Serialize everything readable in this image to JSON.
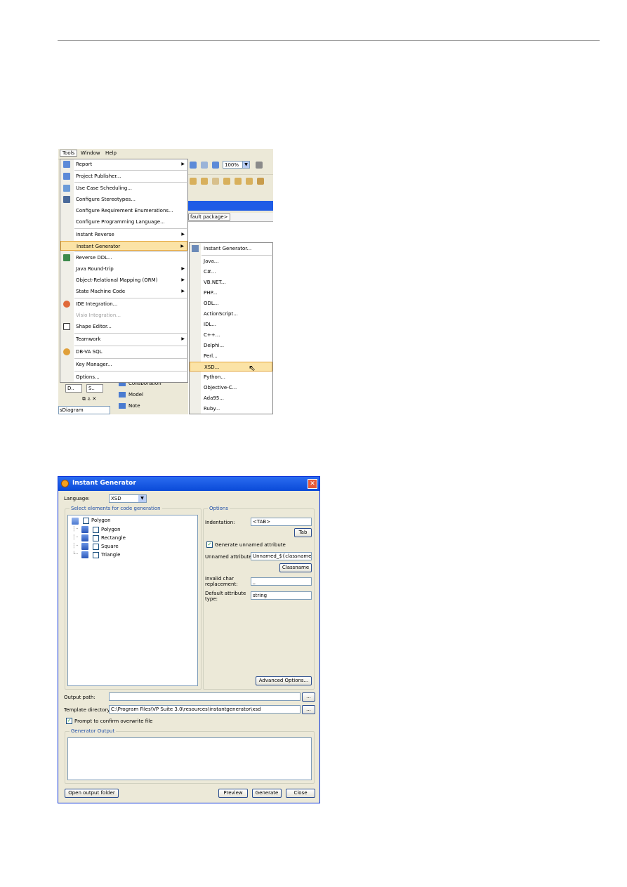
{
  "menubar": {
    "tools": "Tools",
    "window": "Window",
    "help": "Help"
  },
  "toolbar": {
    "zoom": "100%"
  },
  "package_tab": "fault package>",
  "left_panel": {
    "tab1": "D..",
    "tab2": "S..",
    "diagram_select": "sDiagram"
  },
  "diagram_panel": [
    "Collaboration",
    "Model",
    "Note"
  ],
  "tools_menu": [
    {
      "label": "Report",
      "submenu": true
    },
    {
      "label": "Project Publisher..."
    },
    {
      "label": "Use Case Scheduling..."
    },
    {
      "label": "Configure Stereotypes..."
    },
    {
      "label": "Configure Requirement Enumerations..."
    },
    {
      "label": "Configure Programming Language..."
    },
    {
      "label": "Instant Reverse",
      "submenu": true
    },
    {
      "label": "Instant Generator",
      "submenu": true,
      "highlighted": true
    },
    {
      "label": "Reverse DDL..."
    },
    {
      "label": "Java Round-trip",
      "submenu": true
    },
    {
      "label": "Object-Relational Mapping (ORM)",
      "submenu": true
    },
    {
      "label": "State Machine Code",
      "submenu": true
    },
    {
      "label": "IDE Integration..."
    },
    {
      "label": "Visio Integration...",
      "disabled": true
    },
    {
      "label": "Shape Editor..."
    },
    {
      "label": "Teamwork",
      "submenu": true
    },
    {
      "label": "DB-VA SQL"
    },
    {
      "label": "Key Manager..."
    },
    {
      "label": "Options..."
    }
  ],
  "generator_submenu": [
    "Instant Generator...",
    "Java...",
    "C#...",
    "VB.NET...",
    "PHP...",
    "ODL...",
    "ActionScript...",
    "IDL...",
    "C++...",
    "Delphi...",
    "Perl...",
    "XSD...",
    "Python...",
    "Objective-C...",
    "Ada95...",
    "Ruby..."
  ],
  "dialog": {
    "title": "Instant Generator",
    "close_glyph": "✕",
    "language_label": "Language:",
    "language_value": "XSD",
    "select_group": "Select elements for code generation",
    "tree_root": "Polygon",
    "tree_children": [
      "Polygon",
      "Rectangle",
      "Square",
      "Triangle"
    ],
    "options_group": "Options",
    "indentation_label": "Indentation:",
    "indentation_value": "<TAB>",
    "tab_button": "Tab",
    "generate_unnamed": "Generate unnamed attribute",
    "unnamed_label": "Unnamed attribute:",
    "unnamed_value": "Unnamed_${classname}_",
    "classname_button": "Classname",
    "invalid_label_1": "Invalid char",
    "invalid_label_2": "replacement:",
    "invalid_value": "_",
    "default_type_label_1": "Default attribute",
    "default_type_label_2": "type:",
    "default_type_value": "string",
    "advanced_button": "Advanced Options...",
    "output_path_label": "Output path:",
    "output_path_value": "",
    "browse_glyph": "...",
    "template_dir_label": "Template directory:",
    "template_dir_value": "C:\\Program Files\\VP Suite 3.0\\resources\\instantgenerator\\xsd",
    "prompt_overwrite": "Prompt to confirm overwrite file",
    "generator_output_group": "Generator Output",
    "open_folder_button": "Open output folder",
    "preview_button": "Preview",
    "generate_button": "Generate",
    "close_button": "Close"
  },
  "colors": {
    "accent": "#1f5ce6",
    "highlight": "#fbe3a6"
  }
}
